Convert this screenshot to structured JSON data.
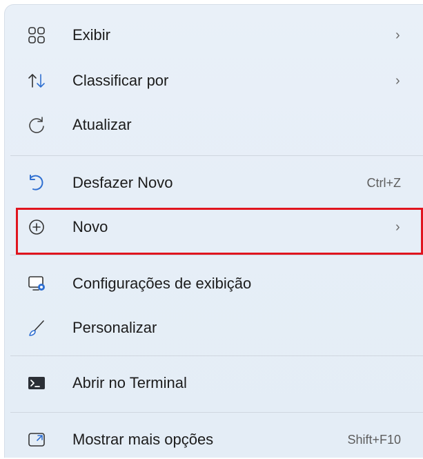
{
  "menu": {
    "items": [
      {
        "label": "Exibir",
        "icon": "grid-view-icon",
        "has_submenu": true
      },
      {
        "label": "Classificar por",
        "icon": "sort-arrows-icon",
        "has_submenu": true
      },
      {
        "label": "Atualizar",
        "icon": "refresh-icon",
        "has_submenu": false
      },
      {
        "label": "Desfazer Novo",
        "icon": "undo-icon",
        "shortcut": "Ctrl+Z"
      },
      {
        "label": "Novo",
        "icon": "add-circle-icon",
        "has_submenu": true,
        "highlighted": true
      },
      {
        "label": "Configurações de exibição",
        "icon": "display-settings-icon"
      },
      {
        "label": "Personalizar",
        "icon": "brush-icon"
      },
      {
        "label": "Abrir no Terminal",
        "icon": "terminal-icon"
      },
      {
        "label": "Mostrar mais opções",
        "icon": "more-options-icon",
        "shortcut": "Shift+F10"
      }
    ],
    "chevron": "›"
  },
  "colors": {
    "highlight_border": "#e0141e",
    "accent_blue": "#2f6fd1"
  }
}
